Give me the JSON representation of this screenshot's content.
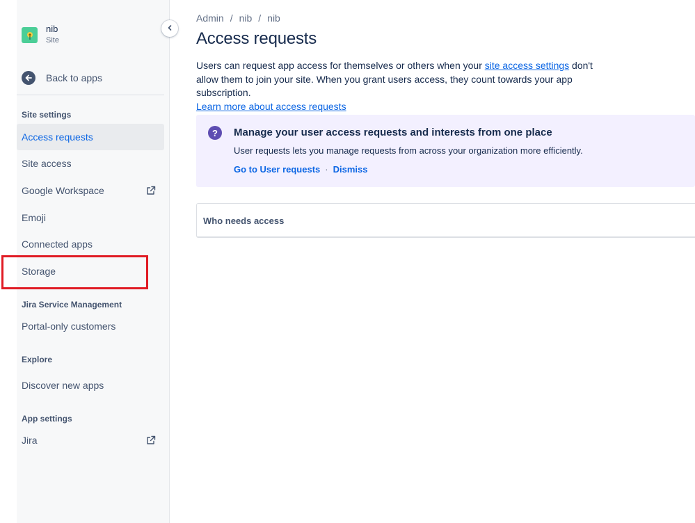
{
  "site": {
    "name": "nib",
    "type": "Site"
  },
  "sidebar": {
    "back_label": "Back to apps",
    "sections": [
      {
        "title": "Site settings"
      },
      {
        "title": "Jira Service Management"
      },
      {
        "title": "Explore"
      },
      {
        "title": "App settings"
      }
    ],
    "items": [
      {
        "label": "Access requests",
        "active": true
      },
      {
        "label": "Site access"
      },
      {
        "label": "Google Workspace",
        "external": true
      },
      {
        "label": "Emoji"
      },
      {
        "label": "Connected apps"
      },
      {
        "label": "Storage",
        "highlighted": true
      },
      {
        "label": "Portal-only customers"
      },
      {
        "label": "Discover new apps"
      },
      {
        "label": "Jira",
        "external": true
      }
    ]
  },
  "breadcrumb": [
    "Admin",
    "nib",
    "nib"
  ],
  "page": {
    "title": "Access requests",
    "intro_part1": "Users can request app access for themselves or others when your ",
    "intro_link": "site access settings",
    "intro_part2": " don't allow them to join your site. When you grant users access, they count towards your app subscription.",
    "learn_more": "Learn more about access requests"
  },
  "info_box": {
    "title": "Manage your user access requests and interests from one place",
    "description": "User requests lets you manage requests from across your organization more efficiently.",
    "primary_action": "Go to User requests",
    "separator": "·",
    "secondary_action": "Dismiss"
  },
  "access_table": {
    "title": "Who needs access"
  },
  "colors": {
    "accent": "#0c66e4",
    "info_bg": "#f3f0ff",
    "info_icon": "#5e4db2",
    "highlight": "#e01b24"
  }
}
